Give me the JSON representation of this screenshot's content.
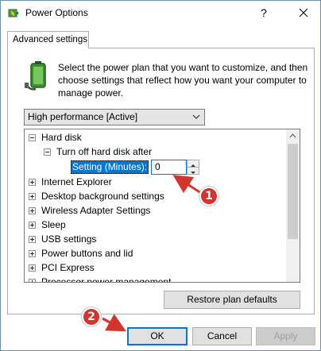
{
  "window": {
    "title": "Power Options",
    "help_glyph": "?"
  },
  "tabs": [
    {
      "label": "Advanced settings"
    }
  ],
  "intro": {
    "text": "Select the power plan that you want to customize, and then choose settings that reflect how you want your computer to manage power."
  },
  "plan_select": {
    "value": "High performance [Active]"
  },
  "tree": {
    "items": [
      {
        "label": "Hard disk",
        "expanded": true
      },
      {
        "label": "Turn off hard disk after",
        "expanded": true
      },
      {
        "label": "Internet Explorer",
        "expanded": false
      },
      {
        "label": "Desktop background settings",
        "expanded": false
      },
      {
        "label": "Wireless Adapter Settings",
        "expanded": false
      },
      {
        "label": "Sleep",
        "expanded": false
      },
      {
        "label": "USB settings",
        "expanded": false
      },
      {
        "label": "Power buttons and lid",
        "expanded": false
      },
      {
        "label": "PCI Express",
        "expanded": false
      },
      {
        "label": "Processor power management",
        "expanded": false
      }
    ],
    "setting_label": "Setting (Minutes):",
    "setting_value": "0"
  },
  "buttons": {
    "restore": "Restore plan defaults",
    "ok": "OK",
    "cancel": "Cancel",
    "apply": "Apply"
  },
  "annotations": {
    "badge1": "1",
    "badge2": "2",
    "color": "#d4342c"
  },
  "colors": {
    "accent": "#0078d7",
    "annotation_red": "#d4342c"
  }
}
